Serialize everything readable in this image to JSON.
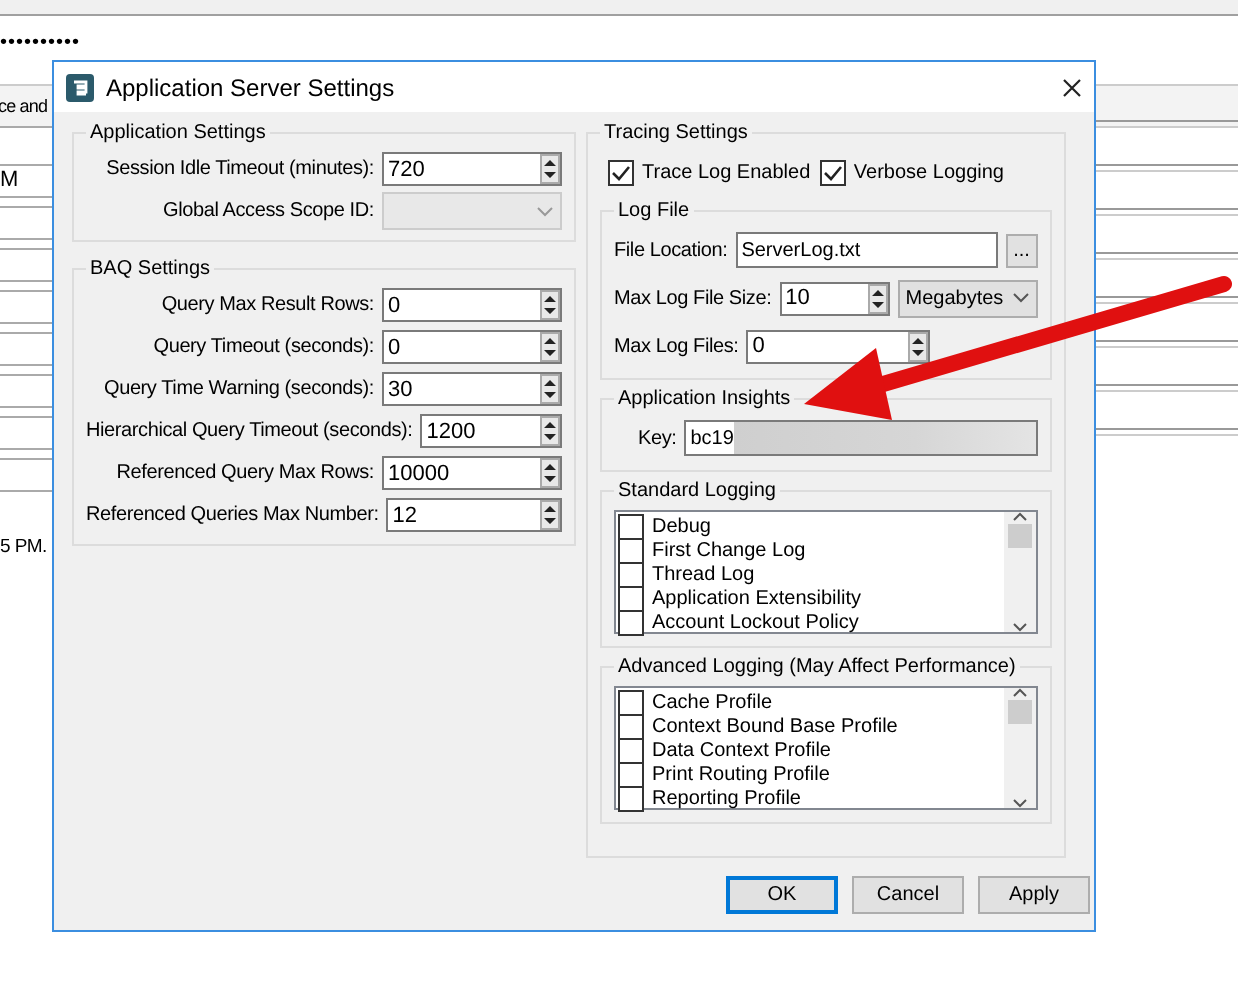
{
  "background": {
    "password": "••••••••••",
    "tab": "ce and",
    "first_field": "M",
    "note": "5 PM."
  },
  "dialog": {
    "title": "Application Server Settings",
    "app_settings": {
      "title": "Application Settings",
      "fields": [
        {
          "kind": "spin",
          "label": "Session Idle Timeout (minutes):",
          "value": "720"
        },
        {
          "kind": "combo",
          "label": "Global Access Scope ID:",
          "disabled": true
        }
      ]
    },
    "baq_settings": {
      "title": "BAQ Settings",
      "fields": [
        {
          "kind": "spin",
          "label": "Query Max Result Rows:",
          "value": "0"
        },
        {
          "kind": "spin",
          "label": "Query Timeout (seconds):",
          "value": "0"
        },
        {
          "kind": "spin",
          "label": "Query Time Warning (seconds):",
          "value": "30"
        },
        {
          "kind": "spin",
          "label": "Hierarchical Query Timeout (seconds):",
          "value": "1200"
        },
        {
          "kind": "spin",
          "label": "Referenced Query Max Rows:",
          "value": "10000"
        },
        {
          "kind": "spin",
          "label": "Referenced Queries Max Number:",
          "value": "12"
        }
      ]
    },
    "tracing": {
      "title": "Tracing Settings",
      "options": [
        {
          "label": "Trace Log Enabled",
          "checked": true
        },
        {
          "label": "Verbose Logging",
          "checked": true
        }
      ],
      "log_file": {
        "title": "Log File",
        "location_label": "File Location:",
        "location": "ServerLog.txt",
        "browse": "...",
        "size_label": "Max Log File Size:",
        "size": "10",
        "unit": "Megabytes",
        "files_label": "Max Log Files:",
        "files": "0"
      },
      "insights": {
        "title": "Application Insights",
        "key_label": "Key:",
        "key": "bc19"
      },
      "standard_logging": {
        "title": "Standard Logging",
        "items": [
          {
            "label": "Debug",
            "checked": false
          },
          {
            "label": "First Change Log",
            "checked": false
          },
          {
            "label": "Thread Log",
            "checked": false
          },
          {
            "label": "Application Extensibility",
            "checked": false
          },
          {
            "label": "Account Lockout Policy",
            "checked": false
          }
        ]
      },
      "advanced_logging": {
        "title": "Advanced Logging (May Affect Performance)",
        "items": [
          {
            "label": "Cache Profile",
            "checked": false
          },
          {
            "label": "Context Bound Base Profile",
            "checked": false
          },
          {
            "label": "Data Context Profile",
            "checked": false
          },
          {
            "label": "Print Routing Profile",
            "checked": false
          },
          {
            "label": "Reporting Profile",
            "checked": false
          }
        ]
      }
    },
    "buttons": [
      {
        "label": "OK",
        "default": true
      },
      {
        "label": "Cancel",
        "default": false
      },
      {
        "label": "Apply",
        "default": false
      }
    ]
  }
}
